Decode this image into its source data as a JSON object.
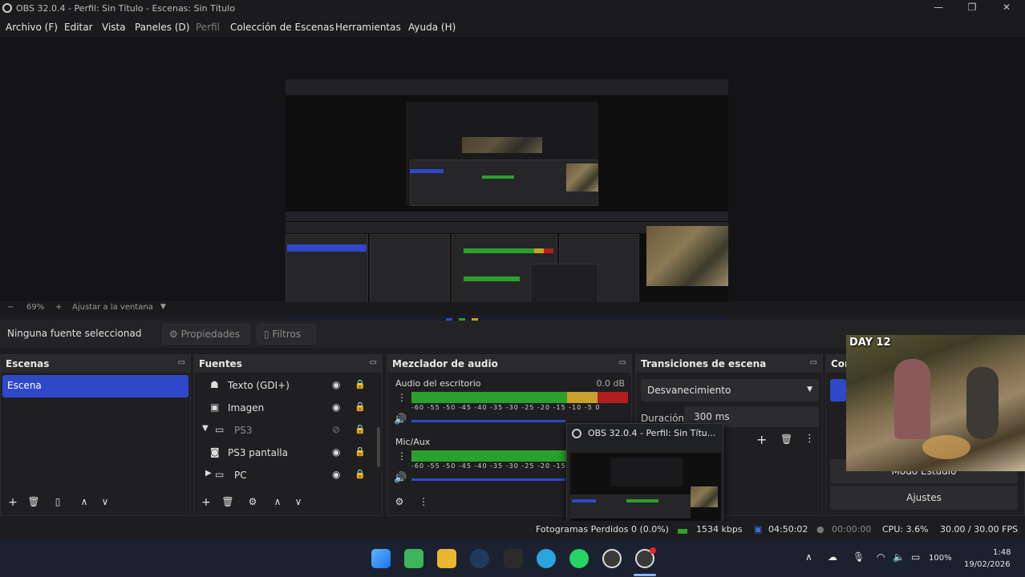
{
  "window": {
    "title": "OBS 32.0.4 - Perfil: Sin Título - Escenas: Sin Título",
    "controls": [
      "—",
      "❐",
      "✕"
    ]
  },
  "menu": [
    {
      "label": "Archivo (F)",
      "disabled": false
    },
    {
      "label": "Editar",
      "disabled": false
    },
    {
      "label": "Vista",
      "disabled": false
    },
    {
      "label": "Paneles (D)",
      "disabled": false
    },
    {
      "label": "Perfil",
      "disabled": true
    },
    {
      "label": "Colección de Escenas",
      "disabled": false
    },
    {
      "label": "Herramientas",
      "disabled": false
    },
    {
      "label": "Ayuda (H)",
      "disabled": false
    }
  ],
  "zoom": {
    "minus": "−",
    "value": "69%",
    "plus": "+",
    "fit_label": "Ajustar a la ventana"
  },
  "source_bar": {
    "no_selection": "Ninguna fuente seleccionad",
    "properties": "Propiedades",
    "filters": "Filtros"
  },
  "scenes": {
    "title": "Escenas",
    "items": [
      "Escena"
    ]
  },
  "sources": {
    "title": "Fuentes",
    "items": [
      {
        "label": "Texto (GDI+)",
        "icon": "text-source-icon",
        "group": false,
        "visible": true,
        "locked": true,
        "indent": false
      },
      {
        "label": "Imagen",
        "icon": "image-source-icon",
        "group": false,
        "visible": true,
        "locked": true,
        "indent": false
      },
      {
        "label": "PS3",
        "icon": "folder-icon",
        "group": true,
        "expanded": true,
        "visible": false,
        "locked": false,
        "indent": false
      },
      {
        "label": "PS3 pantalla",
        "icon": "camera-source-icon",
        "group": false,
        "visible": true,
        "locked": false,
        "indent": true
      },
      {
        "label": "PC",
        "icon": "folder-icon",
        "group": true,
        "expanded": false,
        "visible": true,
        "locked": false,
        "indent": false
      }
    ]
  },
  "mixer": {
    "title": "Mezclador de audio",
    "channels": [
      {
        "name": "Audio del escritorio",
        "db": "0.0 dB",
        "level": 1.0
      },
      {
        "name": "Mic/Aux",
        "db": "",
        "level": 0.78
      }
    ],
    "scale": [
      "-60",
      "-55",
      "-50",
      "-45",
      "-40",
      "-35",
      "-30",
      "-25",
      "-20",
      "-15",
      "-10",
      "-5",
      "0"
    ]
  },
  "transitions": {
    "title": "Transiciones de escena",
    "selected": "Desvanecimiento",
    "duration_label": "Duración",
    "duration_value": "300 ms"
  },
  "controls": {
    "title": "Controles",
    "studio_mode": "Modo Estudio",
    "settings": "Ajustes"
  },
  "status": {
    "frames": "Fotogramas Perdidos 0 (0.0%)",
    "bitrate": "1534 kbps",
    "rec_time": "04:50:02",
    "stream_time": "00:00:00",
    "cpu": "CPU: 3.6%",
    "fps": "30.00 / 30.00 FPS"
  },
  "popup": {
    "title": "OBS 32.0.4 - Perfil: Sin Títu..."
  },
  "camera_overlay": {
    "label": "DAY 12"
  },
  "taskbar": {
    "apps": [
      "windows-start-icon",
      "app-a-icon",
      "file-explorer-icon",
      "steam-icon",
      "epic-games-icon",
      "telegram-icon",
      "whatsapp-icon",
      "obs-studio-icon",
      "obs-active-icon"
    ],
    "battery": "100%",
    "time": "1:48",
    "date": "19/02/2026"
  },
  "colors": {
    "accent": "#2f48c9",
    "meter_green": "#2ca02c",
    "meter_yellow": "#c8a12a",
    "meter_red": "#b31d1d"
  }
}
